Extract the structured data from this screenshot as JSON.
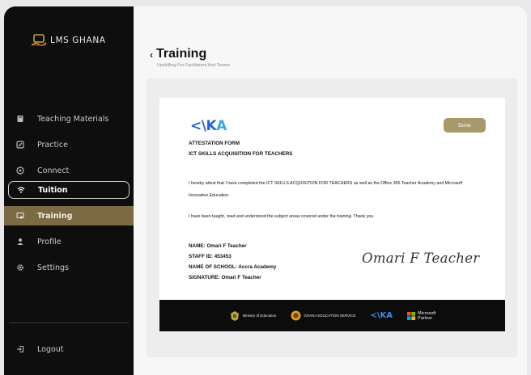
{
  "sidebar": {
    "brand": "LMS GHANA",
    "items": [
      {
        "label": "Teaching Materials",
        "icon": "book-icon"
      },
      {
        "label": "Practice",
        "icon": "pencil-icon"
      },
      {
        "label": "Connect",
        "icon": "connect-icon"
      },
      {
        "label": "Tuition",
        "icon": "wifi-icon"
      },
      {
        "label": "Training",
        "icon": "certificate-icon"
      },
      {
        "label": "Profile",
        "icon": "user-icon"
      },
      {
        "label": "Settings",
        "icon": "gear-icon"
      }
    ],
    "logout": "Logout"
  },
  "header": {
    "title": "Training",
    "subtitle": "Upskilling For Facilitators And Teams"
  },
  "form": {
    "logo_part1": "<\\K",
    "logo_part2": "A",
    "done_label": "Done",
    "heading1": "ATTESTATION FORM",
    "heading2": "ICT SKILLS ACQUISITION FOR TEACHERS",
    "para1_line1": "I hereby attest that I have completed the ICT SKILLS ACQUISITION FOR TEACHERS as well as the Office 365 Teacher Academy and Microsoft",
    "para1_line2": "Innovative Education.",
    "para2": "I have been taught, read and understood the subject areas covered under the training. Thank you.",
    "name": "NAME: Omari F Teacher",
    "staff_id": "STAFF ID: 453453",
    "school": "NAME OF SCHOOL: Accra Academy",
    "signature_label": "SIGNATURE: Omari F Teacher",
    "signature_script": "Omari F Teacher"
  },
  "footer_logos": {
    "moe": "Ministry of Education",
    "ges": "GHANA EDUCATION SERVICE",
    "aka": "<\\KA",
    "ms_line1": "Microsoft",
    "ms_line2": "Partner"
  },
  "colors": {
    "sidebar_bg": "#0e0e0e",
    "active_bg": "#7b6a43",
    "done_bg": "#a9986a",
    "logo_blue": "#2a63d6"
  }
}
